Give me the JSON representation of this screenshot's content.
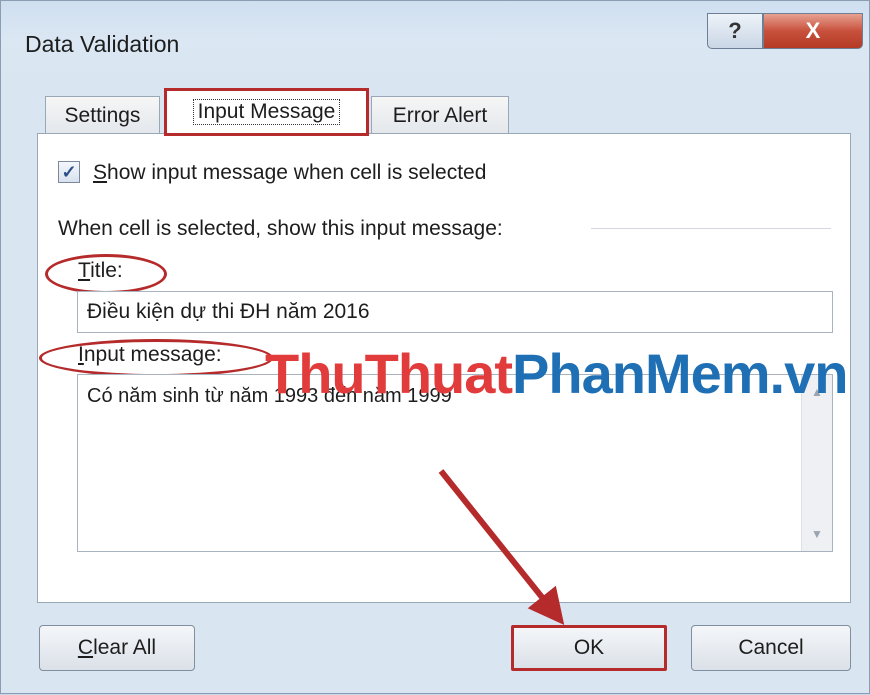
{
  "window": {
    "title": "Data Validation",
    "help_label": "?",
    "close_label": "X"
  },
  "tabs": [
    {
      "label": "Settings"
    },
    {
      "label": "Input Message"
    },
    {
      "label": "Error Alert"
    }
  ],
  "settings": {
    "show_message_label_first": "S",
    "show_message_label_rest": "how input message when cell is selected",
    "show_message_checked": true,
    "section_label": "When cell is selected, show this input message:",
    "title_label_first": "T",
    "title_label_rest": "itle:",
    "title_value": "Điều kiện dự thi ĐH năm 2016",
    "message_label_first": "I",
    "message_label_rest": "nput message:",
    "message_value": "Có năm sinh từ năm 1993 đến năm 1999"
  },
  "watermark": {
    "part1": "ThuThuat",
    "part2": "PhanMem.vn"
  },
  "buttons": {
    "clear_all_first": "C",
    "clear_all_rest": "lear All",
    "ok": "OK",
    "cancel": "Cancel"
  },
  "colors": {
    "highlight": "#b52a2a",
    "watermark_red": "#e23b3b",
    "watermark_blue": "#1f6fb5"
  }
}
